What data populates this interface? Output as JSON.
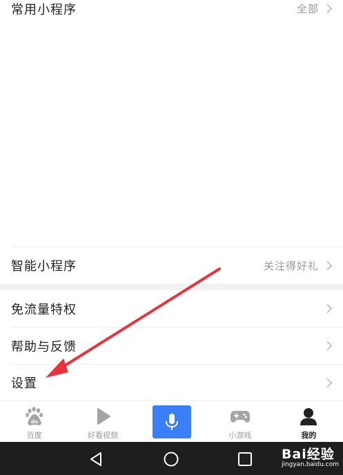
{
  "mini_programs": {
    "title": "常用小程序",
    "all_label": "全部"
  },
  "smart_program": {
    "title": "智能小程序",
    "promo": "关注得好礼"
  },
  "menu": [
    {
      "label": "免流量特权"
    },
    {
      "label": "帮助与反馈"
    },
    {
      "label": "设置"
    }
  ],
  "tabbar": [
    {
      "label": "百度",
      "icon": "baidu-paw-icon"
    },
    {
      "label": "好看视频",
      "icon": "play-icon"
    },
    {
      "label": "",
      "icon": "microphone-icon"
    },
    {
      "label": "小游戏",
      "icon": "gamepad-icon"
    },
    {
      "label": "我的",
      "icon": "person-icon"
    }
  ],
  "system_nav": [
    "back-icon",
    "home-icon",
    "recents-icon"
  ],
  "watermark": {
    "main": "Bai经验",
    "sub": "jingyan.baidu.com"
  },
  "colors": {
    "accent": "#3a7ff5",
    "arrow": "#e8323c",
    "nav_bg": "#1e1e1e"
  }
}
